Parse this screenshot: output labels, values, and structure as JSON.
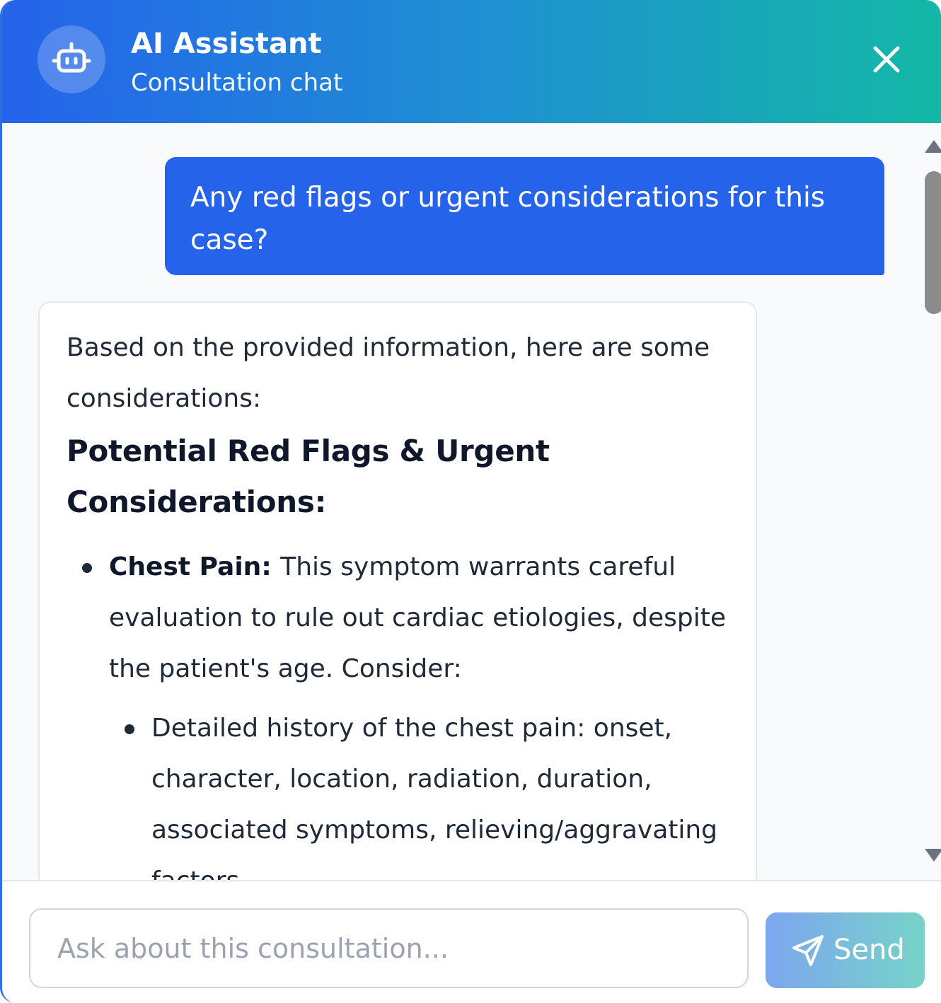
{
  "header": {
    "title": "AI Assistant",
    "subtitle": "Consultation chat",
    "avatar_icon": "robot-icon",
    "close_icon": "close-icon",
    "gradient_start": "#2563eb",
    "gradient_end": "#14b8a6"
  },
  "messages": {
    "user_message": "Any red flags or urgent considerations for this case?",
    "assistant": {
      "intro": "Based on the provided information, here are some considerations:",
      "heading": "Potential Red Flags & Urgent Considerations:",
      "items": [
        {
          "label": "Chest Pain:",
          "text": "This symptom warrants careful evaluation to rule out cardiac etiologies, despite the patient's age. Consider:",
          "subitems": [
            "Detailed history of the chest pain: onset, character, location, radiation, duration, associated symptoms, relieving/aggravating factors."
          ]
        }
      ]
    }
  },
  "composer": {
    "placeholder": "Ask about this consultation...",
    "value": "",
    "send_label": "Send",
    "send_icon": "send-icon"
  },
  "colors": {
    "user_bubble": "#2563eb",
    "assistant_bubble": "#ffffff",
    "messages_background": "#f8fafc"
  }
}
